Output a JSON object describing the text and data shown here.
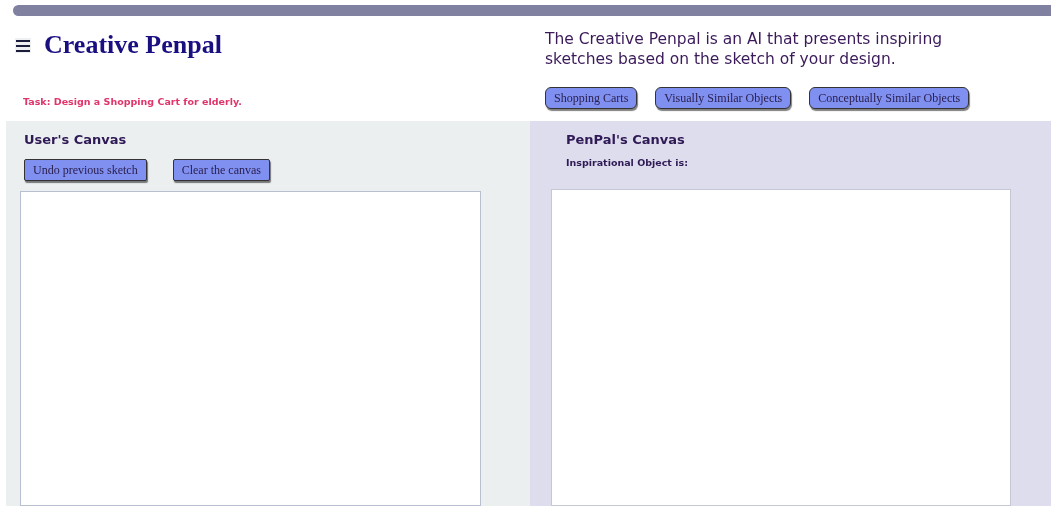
{
  "title": "Creative Penpal",
  "description": "The Creative Penpal is an AI that presents inspiring sketches based on the sketch of your design.",
  "task": "Task: Design a Shopping Cart for elderly.",
  "category_buttons": [
    "Shopping Carts",
    "Visually Similar Objects",
    "Conceptually Similar Objects"
  ],
  "user_canvas": {
    "heading": "User's Canvas",
    "buttons": [
      "Undo previous sketch",
      "Clear the canvas"
    ]
  },
  "penpal_canvas": {
    "heading": "PenPal's Canvas",
    "subheading": "Inspirational Object is:"
  }
}
